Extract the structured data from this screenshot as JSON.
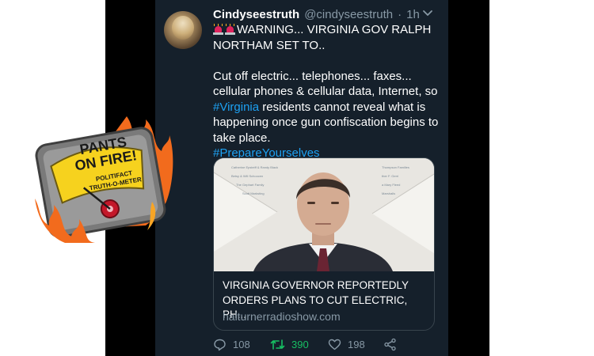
{
  "tweet": {
    "display_name": "Cindyseestruth",
    "handle": "@cindyseestruth",
    "separator": "·",
    "time": "1h",
    "lines": [
      "WARNING... VIRGINIA GOV RALPH",
      "NORTHAM SET TO..",
      "Cut off electric... telephones... faxes...",
      "cellular phones & cellular data, Internet, so",
      "residents cannot reveal what is",
      "happening once gun confiscation begins to",
      "take place."
    ],
    "hashtag_virginia": "#Virginia",
    "hashtag_prepare": "#PrepareYourselves"
  },
  "card": {
    "title_line1": "VIRGINIA GOVERNOR REPORTEDLY",
    "title_line2": "ORDERS PLANS TO CUT ELECTRIC, PH...",
    "domain": "halturnerradioshow.com",
    "image_plaque_names": [
      "Catherine Epsteiff & Randy Black",
      "Betsy & Will Schoocen",
      "The Gephart Family",
      "Scott Marksting",
      "Thompson Families",
      "ther F. Gerri",
      "a Mary Fleed",
      "Marshalls"
    ]
  },
  "actions": {
    "replies": "108",
    "retweets": "390",
    "likes": "198"
  },
  "badge": {
    "line1": "PANTS",
    "line2": "ON FIRE!",
    "brand": "POLITIFACT",
    "meter": "TRUTH-O-METER"
  },
  "colors": {
    "background": "#15202b",
    "link": "#1da1f2",
    "retweet": "#17bf63",
    "muted": "#8899a6",
    "badge_yellow": "#f6d21e",
    "flame_orange": "#f26b1d"
  }
}
